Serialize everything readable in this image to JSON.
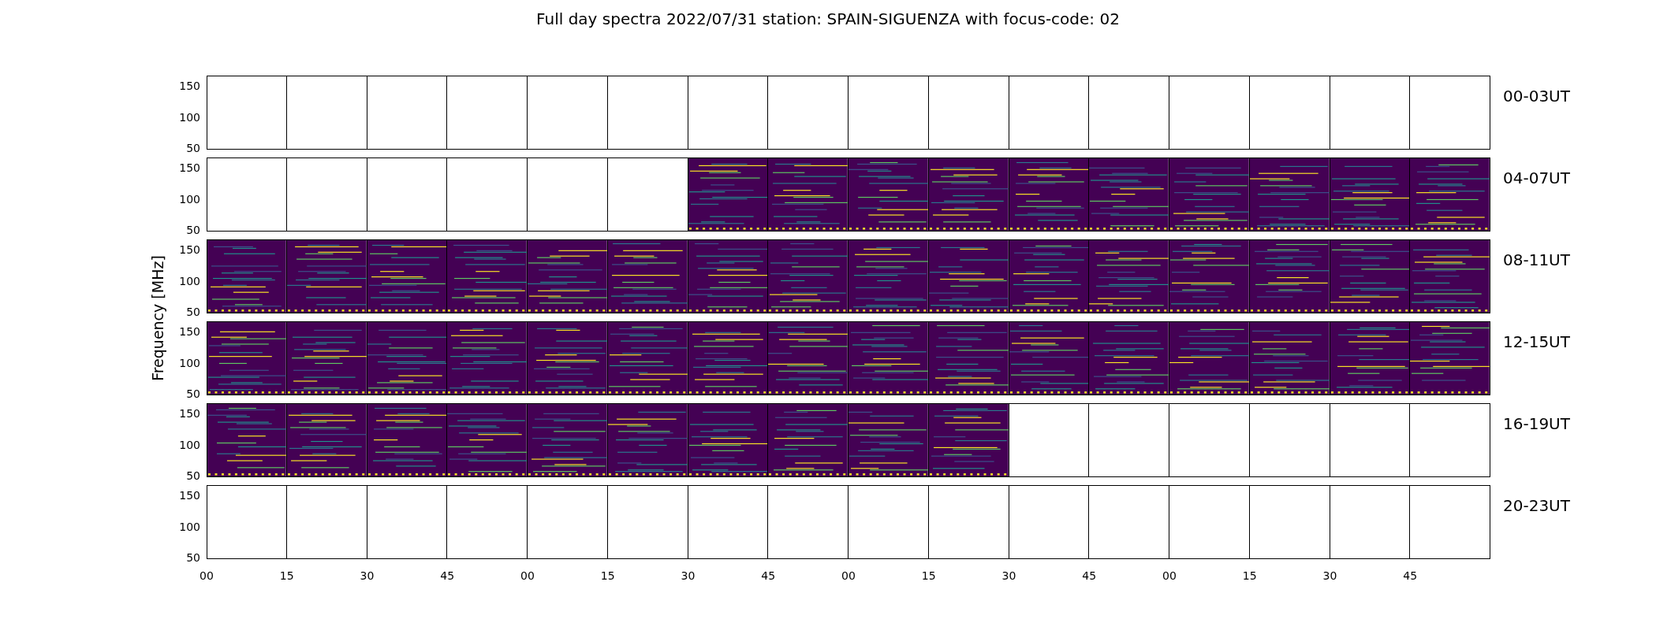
{
  "title": "Full day spectra 2022/07/31 station: SPAIN-SIGUENZA with focus-code: 02",
  "ylabel": "Frequency [MHz]",
  "xticks": [
    "00",
    "15",
    "30",
    "45",
    "00",
    "15",
    "30",
    "45",
    "00",
    "15",
    "30",
    "45",
    "00",
    "15",
    "30",
    "45"
  ],
  "rows": [
    {
      "label": "00-03UT",
      "yticks": [
        "150",
        "100",
        "50"
      ],
      "panels": [
        false,
        false,
        false,
        false,
        false,
        false,
        false,
        false,
        false,
        false,
        false,
        false,
        false,
        false,
        false,
        false
      ]
    },
    {
      "label": "04-07UT",
      "yticks": [
        "150",
        "100",
        "50"
      ],
      "panels": [
        false,
        false,
        false,
        false,
        false,
        false,
        true,
        true,
        true,
        true,
        true,
        true,
        true,
        true,
        true,
        true
      ]
    },
    {
      "label": "08-11UT",
      "yticks": [
        "150",
        "100",
        "50"
      ],
      "panels": [
        true,
        true,
        true,
        true,
        true,
        true,
        true,
        true,
        true,
        true,
        true,
        true,
        true,
        true,
        true,
        true
      ]
    },
    {
      "label": "12-15UT",
      "yticks": [
        "150",
        "100",
        "50"
      ],
      "panels": [
        true,
        true,
        true,
        true,
        true,
        true,
        true,
        true,
        true,
        true,
        true,
        true,
        true,
        true,
        true,
        true
      ]
    },
    {
      "label": "16-19UT",
      "yticks": [
        "150",
        "100",
        "50"
      ],
      "panels": [
        true,
        true,
        true,
        true,
        true,
        true,
        true,
        true,
        true,
        true,
        false,
        false,
        false,
        false,
        false,
        false
      ]
    },
    {
      "label": "20-23UT",
      "yticks": [
        "150",
        "100",
        "50"
      ],
      "panels": [
        false,
        false,
        false,
        false,
        false,
        false,
        false,
        false,
        false,
        false,
        false,
        false,
        false,
        false,
        false,
        false
      ]
    }
  ]
}
